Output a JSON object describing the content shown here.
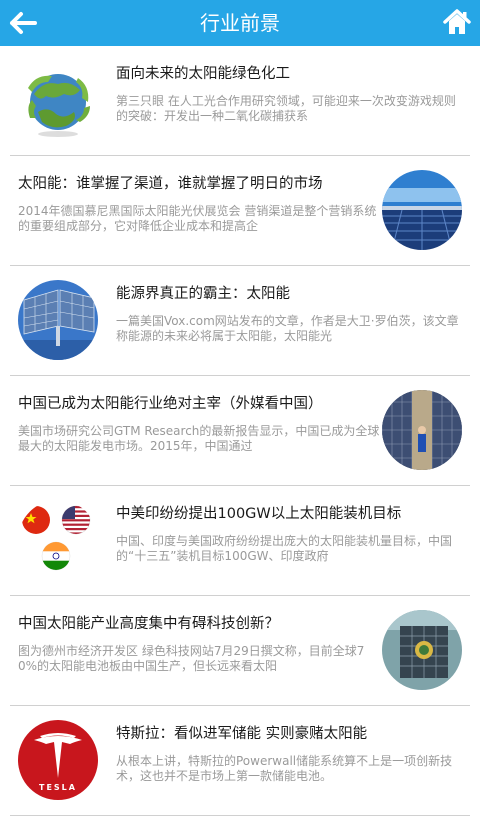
{
  "header": {
    "title": "行业前景",
    "back_icon": "arrow-left-icon",
    "home_icon": "home-icon",
    "color": "#26a6e6"
  },
  "items": [
    {
      "title": "面向未来的太阳能绿色化工",
      "desc": "        第三只眼        在人工光合作用研究领域，可能迎来一次改变游戏规则的突破：开发出一种二氧化碳捕获系",
      "thumb": "green-earth-thumbnail"
    },
    {
      "title": "太阳能：谁掌握了渠道，谁就掌握了明日的市场",
      "desc": "2014年德国慕尼黑国际太阳能光伏展览会        营销渠道是整个营销系统的重要组成部分，它对降低企业成本和提高企",
      "thumb": "solar-farm-thumbnail"
    },
    {
      "title": "能源界真正的霸主：太阳能",
      "desc": "        一篇美国Vox.com网站发布的文章，作者是大卫·罗伯茨，该文章称能源的未来必将属于太阳能，太阳能光",
      "thumb": "solar-panels-sky-thumbnail"
    },
    {
      "title": "中国已成为太阳能行业绝对主宰（外媒看中国）",
      "desc": "        美国市场研究公司GTM Research的最新报告显示，中国已成为全球最大的太阳能发电市场。2015年，中国通过",
      "thumb": "solar-rows-worker-thumbnail"
    },
    {
      "title": "中美印纷纷提出100GW以上太阳能装机目标",
      "desc": "        中国、印度与美国政府纷纷提出庞大的太阳能装机量目标，中国的“十三五”装机目标100GW、印度政府",
      "thumb": "flags-china-usa-india-thumbnail"
    },
    {
      "title": "中国太阳能产业高度集中有碍科技创新？",
      "desc": "图为德州市经济开发区        绿色科技网站7月29日撰文称，目前全球70%的太阳能电池板由中国生产，但长远来看太阳",
      "thumb": "solar-panel-closeup-thumbnail"
    },
    {
      "title": "特斯拉：看似进军储能 实则豪赌太阳能",
      "desc": "        从根本上讲，特斯拉的Powerwall储能系统算不上是一项创新技术，这也并不是市场上第一款储能电池。",
      "thumb": "tesla-logo-thumbnail",
      "logo_text": "TESLA"
    }
  ]
}
